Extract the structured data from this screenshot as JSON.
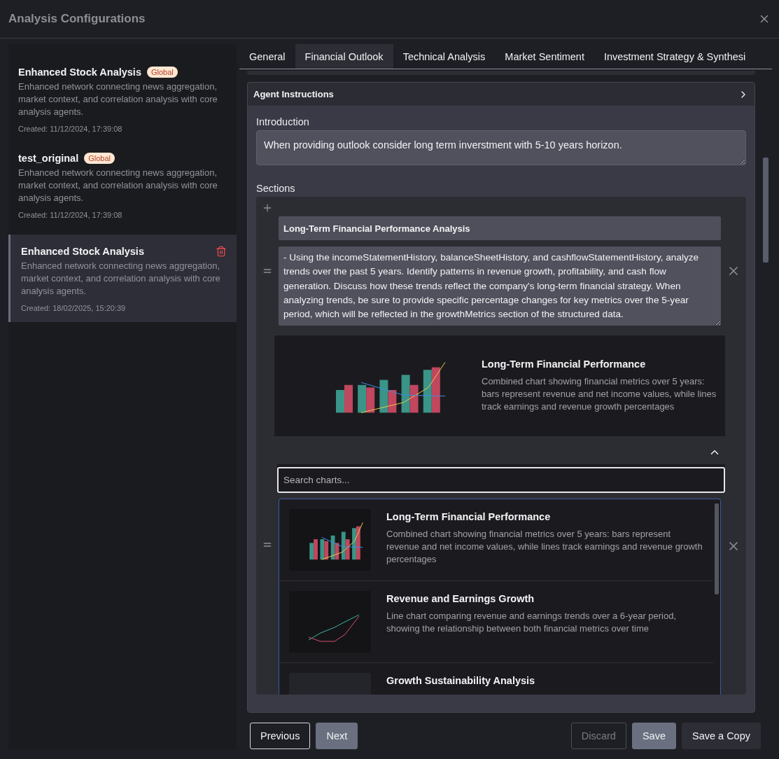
{
  "window": {
    "title": "Analysis Configurations"
  },
  "sidebar": {
    "items": [
      {
        "title": "Enhanced Stock Analysis",
        "badge": "Global",
        "description": "Enhanced network connecting news aggregation, market context, and correlation analysis with core analysis agents.",
        "created": "Created: 11/12/2024, 17:39:08",
        "selected": false
      },
      {
        "title": "test_original",
        "badge": "Global",
        "description": "Enhanced network connecting news aggregation, market context, and correlation analysis with core analysis agents.",
        "created": "Created: 11/12/2024, 17:39:08",
        "selected": false
      },
      {
        "title": "Enhanced Stock Analysis",
        "description": "Enhanced network connecting news aggregation, market context, and correlation analysis with core analysis agents.",
        "created": "Created: 18/02/2025, 15:20:39",
        "selected": true
      }
    ]
  },
  "tabs": [
    {
      "label": "General",
      "selected": false
    },
    {
      "label": "Financial Outlook",
      "selected": true
    },
    {
      "label": "Technical Analysis",
      "selected": false
    },
    {
      "label": "Market Sentiment",
      "selected": false
    },
    {
      "label": "Investment Strategy & Synthesi",
      "selected": false
    }
  ],
  "agent_instructions": {
    "title": "Agent Instructions",
    "expanded": false
  },
  "introduction": {
    "label": "Introduction",
    "value": "When providing outlook consider long term inverstment with 5-10 years horizon."
  },
  "sections": {
    "label": "Sections",
    "items": [
      {
        "title": "Long-Term Financial Performance Analysis",
        "body": "- Using the incomeStatementHistory, balanceSheetHistory, and cashflowStatementHistory, analyze trends over the past 5 years. Identify patterns in revenue growth, profitability, and cash flow generation. Discuss how these trends reflect the company's long-term financial strategy. When analyzing trends, be sure to provide specific percentage changes for key metrics over the 5-year period, which will be reflected in the growthMetrics section of the structured data.",
        "chart": {
          "kind": "bars",
          "title": "Long-Term Financial Performance",
          "description": "Combined chart showing financial metrics over 5 years: bars represent revenue and net income values, while lines track earnings and revenue growth percentages"
        }
      }
    ],
    "picker": {
      "expanded": true,
      "placeholder": "Search charts...",
      "options": [
        {
          "kind": "bars",
          "title": "Long-Term Financial Performance",
          "description": "Combined chart showing financial metrics over 5 years: bars represent revenue and net income values, while lines track earnings and revenue growth percentages"
        },
        {
          "kind": "lines",
          "title": "Revenue and Earnings Growth",
          "description": "Line chart comparing revenue and earnings trends over a 6-year period, showing the relationship between both financial metrics over time"
        },
        {
          "kind": "blank",
          "title": "Growth Sustainability Analysis"
        }
      ]
    }
  },
  "footer": {
    "buttons": [
      {
        "label": "Previous",
        "kind": "outline"
      },
      {
        "label": "Next",
        "kind": "filled"
      },
      {
        "label": "Discard",
        "kind": "disabled"
      },
      {
        "label": "Save",
        "kind": "filled"
      },
      {
        "label": "Save a Copy",
        "kind": "dark"
      }
    ]
  }
}
